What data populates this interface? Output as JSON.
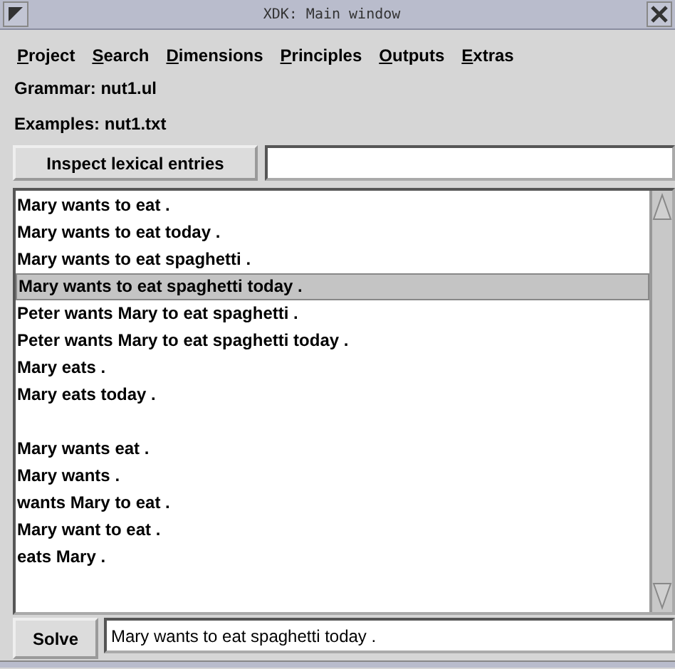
{
  "window": {
    "title": "XDK: Main window"
  },
  "menu": [
    {
      "label": "Project"
    },
    {
      "label": "Search"
    },
    {
      "label": "Dimensions"
    },
    {
      "label": "Principles"
    },
    {
      "label": "Outputs"
    },
    {
      "label": "Extras"
    }
  ],
  "info": [
    "Grammar: nut1.ul",
    "Examples: nut1.txt"
  ],
  "inspect_button": "Inspect lexical entries",
  "examples": [
    {
      "kind": "sentence",
      "text": "Mary wants to eat .",
      "selected": false
    },
    {
      "kind": "sentence",
      "text": "Mary wants to eat today .",
      "selected": false
    },
    {
      "kind": "sentence",
      "text": "Mary wants to eat spaghetti .",
      "selected": false
    },
    {
      "kind": "sentence",
      "text": "Mary wants to eat spaghetti today .",
      "selected": true
    },
    {
      "kind": "sentence",
      "text": "Peter wants Mary to eat spaghetti .",
      "selected": false
    },
    {
      "kind": "sentence",
      "text": "Peter wants Mary to eat spaghetti today .",
      "selected": false
    },
    {
      "kind": "sentence",
      "text": "Mary eats .",
      "selected": false
    },
    {
      "kind": "sentence",
      "text": "Mary eats today .",
      "selected": false
    },
    {
      "kind": "blank"
    },
    {
      "kind": "sentence",
      "text": "Mary wants eat .",
      "selected": false
    },
    {
      "kind": "sentence",
      "text": "Mary wants .",
      "selected": false
    },
    {
      "kind": "sentence",
      "text": "wants Mary to eat .",
      "selected": false
    },
    {
      "kind": "sentence",
      "text": "Mary want to eat .",
      "selected": false
    },
    {
      "kind": "sentence",
      "text": "eats Mary .",
      "selected": false
    }
  ],
  "solve_button": "Solve",
  "sentence_field": {
    "value": "Mary wants to eat spaghetti today ."
  }
}
